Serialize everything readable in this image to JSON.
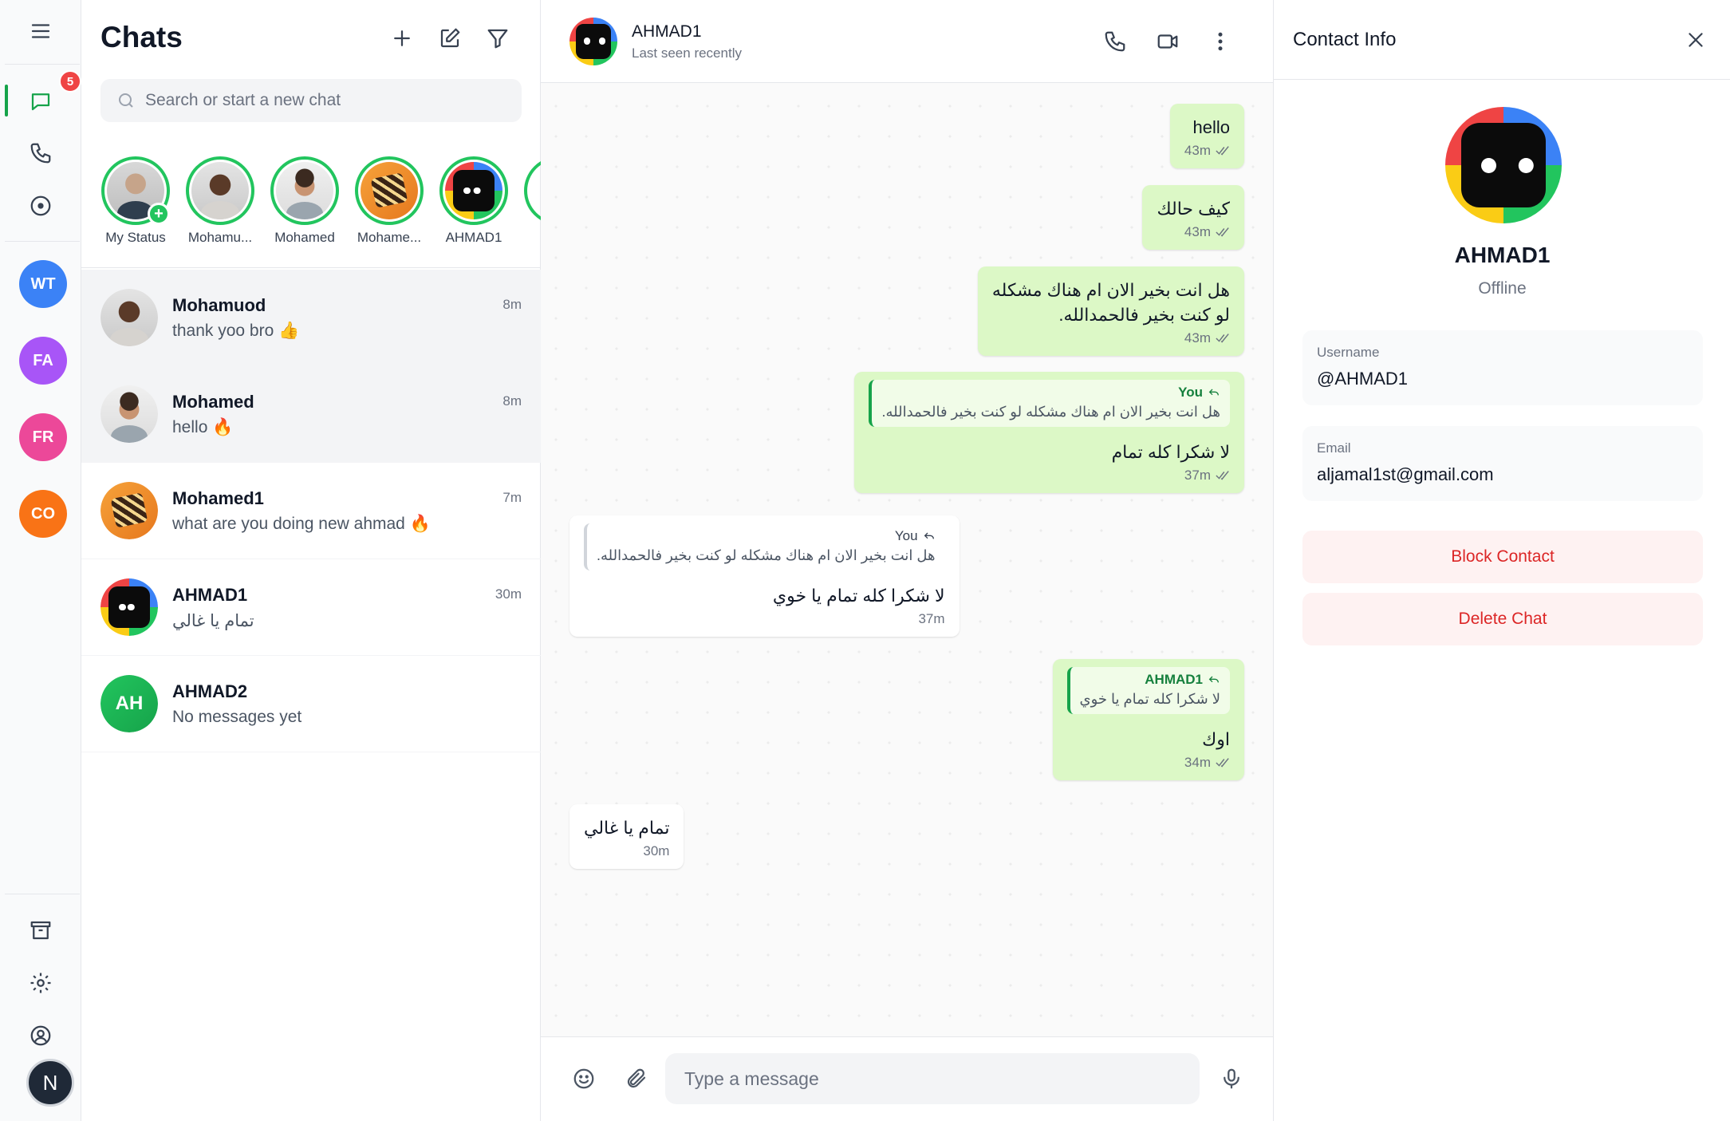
{
  "rail": {
    "badge": "5",
    "groups": [
      {
        "initials": "WT",
        "color": "#3b82f6"
      },
      {
        "initials": "FA",
        "color": "#a855f7"
      },
      {
        "initials": "FR",
        "color": "#ec4899"
      },
      {
        "initials": "CO",
        "color": "#f97316"
      }
    ],
    "me_initial": "N"
  },
  "list": {
    "title": "Chats",
    "search_placeholder": "Search or start a new chat",
    "stories": [
      {
        "label": "My Status"
      },
      {
        "label": "Mohamu..."
      },
      {
        "label": "Mohamed"
      },
      {
        "label": "Mohame..."
      },
      {
        "label": "AHMAD1"
      },
      {
        "label": "."
      }
    ],
    "chats": [
      {
        "name": "Mohamuod",
        "preview": "thank yoo bro 👍",
        "time": "8m"
      },
      {
        "name": "Mohamed",
        "preview": "hello 🔥",
        "time": "8m"
      },
      {
        "name": "Mohamed1",
        "preview": "what are you doing new ahmad 🔥",
        "time": "7m"
      },
      {
        "name": "AHMAD1",
        "preview": "تمام يا غالي",
        "time": "30m"
      },
      {
        "name": "AHMAD2",
        "preview": "No messages yet",
        "time": "",
        "initials": "AH"
      }
    ]
  },
  "conversation": {
    "name": "AHMAD1",
    "status": "Last seen recently",
    "messages": [
      {
        "text": "hello",
        "time": "43m"
      },
      {
        "text": "كيف حالك",
        "time": "43m"
      },
      {
        "line1": "هل انت بخير الان ام هناك مشكله",
        "line2": "لو كنت بخير فالحمدالله.",
        "time": "43m"
      },
      {
        "quote_who": "You",
        "quote_text": "هل انت بخير الان ام هناك مشكله لو كنت بخير فالحمدالله.",
        "text": "لا شكرا كله تمام",
        "time": "37m"
      },
      {
        "quote_who": "You",
        "quote_text": "هل انت بخير الان ام هناك مشكله لو كنت بخير فالحمدالله.",
        "text": "لا شكرا كله تمام يا خوي",
        "time": "37m"
      },
      {
        "quote_who": "AHMAD1",
        "quote_text": "لا شكرا كله تمام يا خوي",
        "text": "اوك",
        "time": "34m"
      },
      {
        "text": "تمام يا غالي",
        "time": "30m"
      }
    ],
    "composer_placeholder": "Type a message"
  },
  "contact": {
    "title": "Contact Info",
    "name": "AHMAD1",
    "status": "Offline",
    "username_label": "Username",
    "username": "@AHMAD1",
    "email_label": "Email",
    "email": "aljamal1st@gmail.com",
    "block_label": "Block Contact",
    "delete_label": "Delete Chat"
  },
  "colors": {
    "accent": "#16a34a",
    "bubble_out": "#dcf8c6",
    "danger": "#dc2626"
  }
}
